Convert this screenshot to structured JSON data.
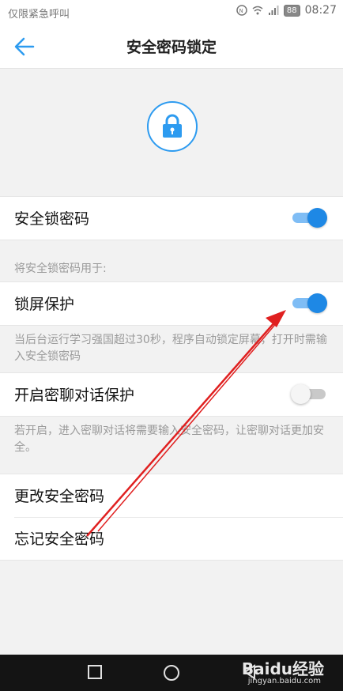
{
  "status_bar": {
    "carrier_text": "仅限紧急呼叫",
    "battery": "88",
    "time": "08:27"
  },
  "header": {
    "title": "安全密码锁定",
    "back_icon": "arrow-left-icon"
  },
  "lock_icon": "lock-icon",
  "settings": {
    "security_lock_label": "安全锁密码",
    "security_lock_on": true,
    "use_for_label": "将安全锁密码用于:",
    "screen_lock_label": "锁屏保护",
    "screen_lock_on": true,
    "screen_lock_hint": "当后台运行学习强国超过30秒，程序自动锁定屏幕，打开时需输入安全锁密码",
    "chat_protect_label": "开启密聊对话保护",
    "chat_protect_on": false,
    "chat_protect_hint": "若开启，进入密聊对话将需要输入安全密码，让密聊对话更加安全。",
    "change_password_label": "更改安全密码",
    "forgot_password_label": "忘记安全密码"
  },
  "watermark": {
    "brand": "Baidu经验",
    "url": "jingyan.baidu.com"
  },
  "colors": {
    "accent": "#1e88e5",
    "annotation_arrow": "#e02020"
  }
}
